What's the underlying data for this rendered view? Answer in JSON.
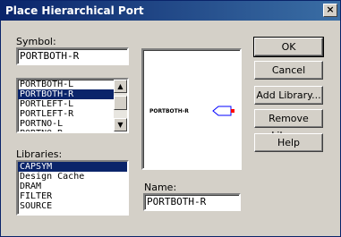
{
  "window": {
    "title": "Place Hierarchical Port",
    "close_glyph": "×"
  },
  "symbol": {
    "label": "Symbol:",
    "value": "PORTBOTH-R",
    "list": [
      "PORTBOTH-L",
      "PORTBOTH-R",
      "PORTLEFT-L",
      "PORTLEFT-R",
      "PORTNO-L",
      "PORTNO-R"
    ],
    "selected_index": 1
  },
  "libraries": {
    "label": "Libraries:",
    "list": [
      "CAPSYM",
      "Design Cache",
      "DRAM",
      "FILTER",
      "SOURCE"
    ],
    "selected_index": 0
  },
  "preview": {
    "port_label": "PORTBOTH-R"
  },
  "name": {
    "label": "Name:",
    "value": "PORTBOTH-R"
  },
  "buttons": {
    "ok": "OK",
    "cancel": "Cancel",
    "add_library": "Add Library...",
    "remove_library": "Remove Library",
    "help": "Help"
  },
  "colors": {
    "title_start": "#0a246a",
    "title_end": "#3a6ea5",
    "selection": "#0a246a",
    "port_shape": "#0000ff",
    "port_pin": "#ff0000"
  }
}
